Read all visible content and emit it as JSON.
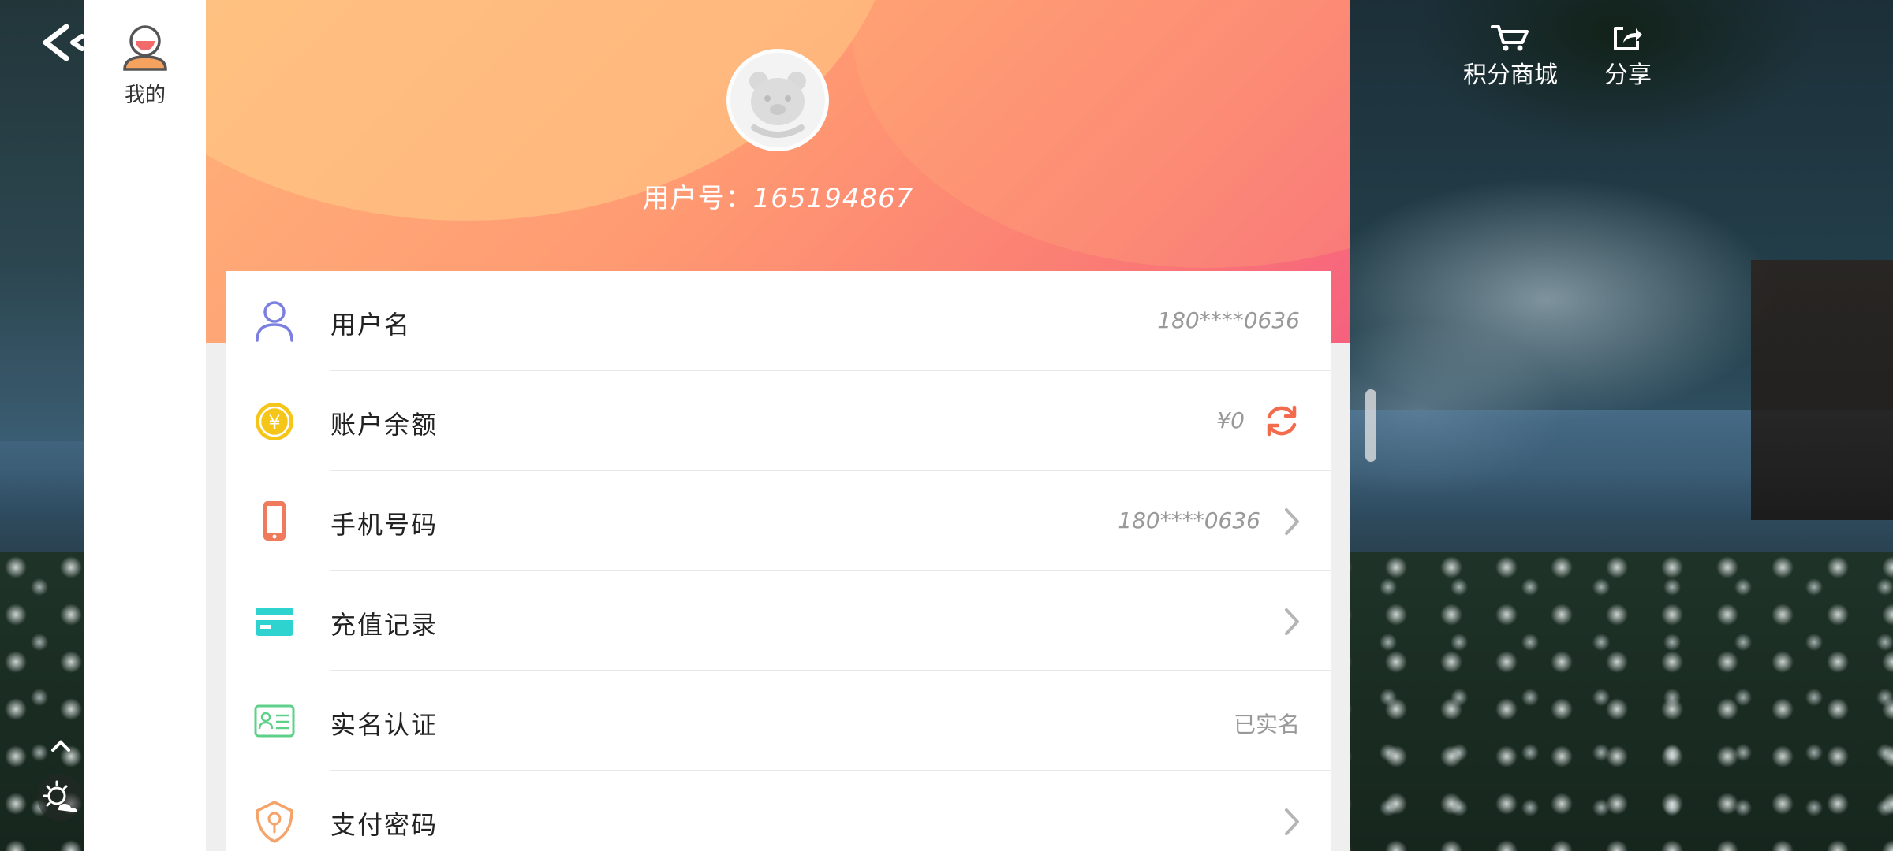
{
  "left_rail": {
    "profile_tab_label": "我的"
  },
  "header": {
    "user_id_label": "用户号：",
    "user_id_value": "165194867",
    "points_mall_label": "积分商城",
    "share_label": "分享"
  },
  "rows": [
    {
      "label": "用户名",
      "value": "180****0636",
      "icon": "user-icon"
    },
    {
      "label": "账户余额",
      "value": "¥0",
      "icon": "coin-icon"
    },
    {
      "label": "手机号码",
      "value": "180****0636",
      "icon": "phone-icon"
    },
    {
      "label": "充值记录",
      "value": "",
      "icon": "card-icon"
    },
    {
      "label": "实名认证",
      "value": "已实名",
      "icon": "id-card-icon"
    },
    {
      "label": "支付密码",
      "value": "",
      "icon": "lock-shield-icon"
    }
  ],
  "colors": {
    "header_start": "#ffb27a",
    "header_end": "#f6617e",
    "user_icon": "#7b7fe0",
    "coin_icon": "#f5c518",
    "phone_icon": "#f07a5c",
    "card_icon": "#2ed3cf",
    "id_card_icon": "#5fd08a",
    "lock_icon": "#f4a36a",
    "refresh_icon": "#f26b4c"
  }
}
